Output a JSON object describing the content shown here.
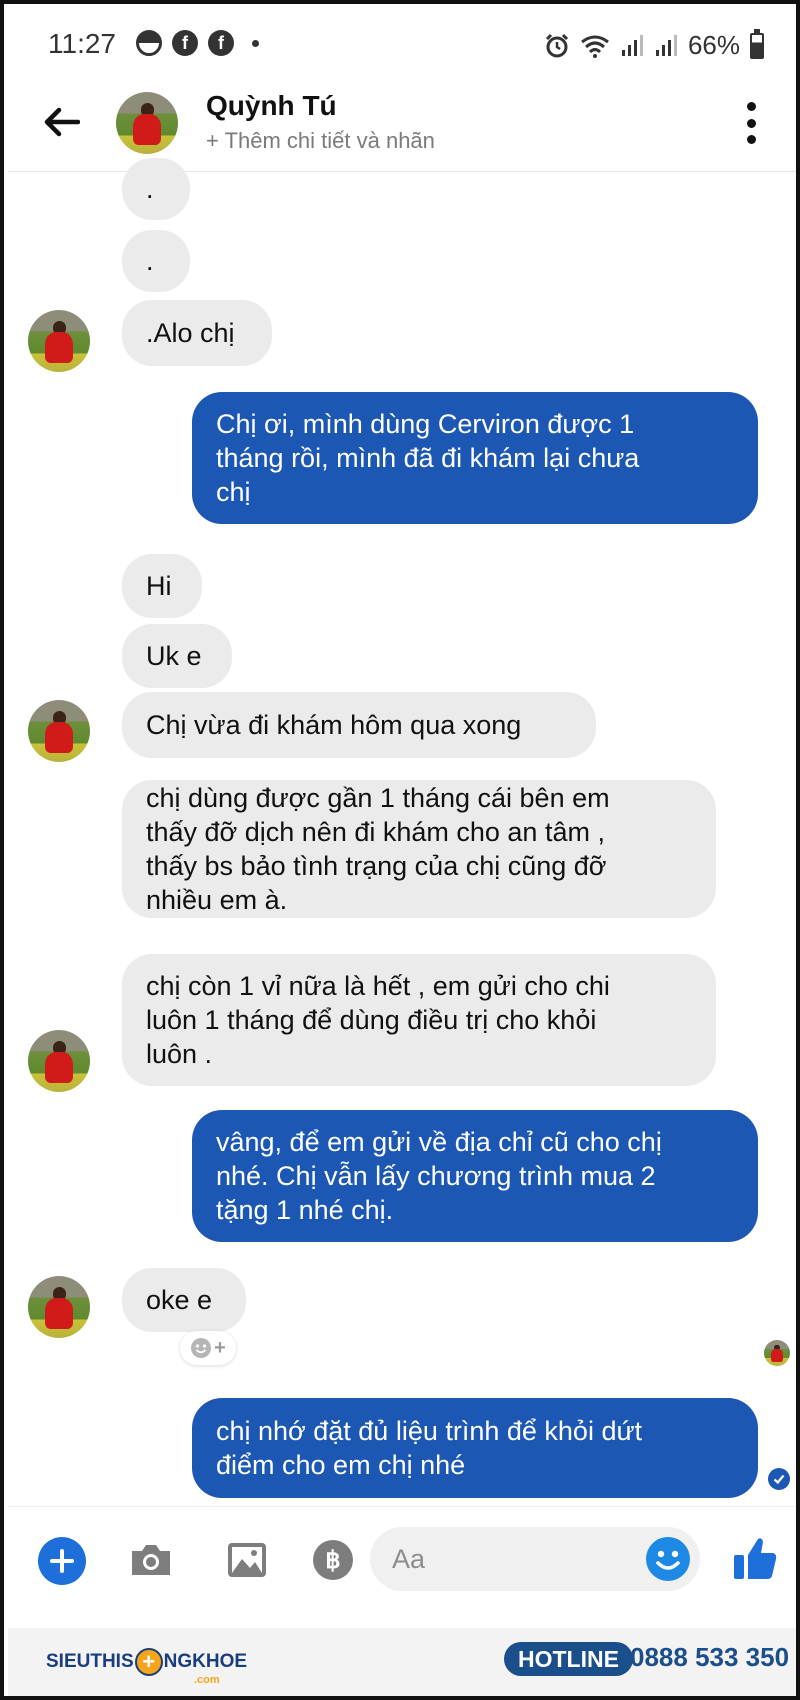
{
  "status_bar": {
    "time": "11:27",
    "battery": "66%"
  },
  "header": {
    "contact_name": "Quỳnh Tú",
    "subtitle": "+ Thêm chi tiết và nhãn"
  },
  "messages": [
    {
      "direction": "incoming",
      "text": "."
    },
    {
      "direction": "incoming",
      "text": "."
    },
    {
      "direction": "incoming",
      "text": ".Alo chị"
    },
    {
      "direction": "outgoing",
      "text": "Chị ơi, mình dùng Cerviron được 1\ntháng rồi, mình đã đi khám lại chưa\nchị"
    },
    {
      "direction": "incoming",
      "text": "Hi"
    },
    {
      "direction": "incoming",
      "text": "Uk e"
    },
    {
      "direction": "incoming",
      "text": "Chị vừa đi khám hôm qua xong"
    },
    {
      "direction": "incoming",
      "text": "chị dùng được gần 1 tháng cái bên em\nthấy đỡ dịch nên đi khám cho an tâm ,\nthấy bs bảo tình trạng của chị cũng đỡ\nnhiều em à."
    },
    {
      "direction": "incoming",
      "text": "chị còn 1 vỉ nữa là hết , em gửi cho chi\nluôn 1 tháng để dùng điều trị cho khỏi\nluôn ."
    },
    {
      "direction": "outgoing",
      "text": "vâng, để em gửi về địa chỉ cũ cho chị\nnhé. Chị vẫn lấy chương trình mua 2\ntặng 1 nhé chị."
    },
    {
      "direction": "incoming",
      "text": "oke e"
    },
    {
      "direction": "outgoing",
      "text": "chị nhớ đặt đủ liệu trình để khỏi dứt\nđiểm cho em chị nhé"
    }
  ],
  "reaction_add_label": "+",
  "composer": {
    "placeholder": "Aa"
  },
  "footer": {
    "brand_left": "SIEUTHIS",
    "brand_right": "NGKHOE",
    "brand_domain": ".com",
    "hotline_label": "HOTLINE",
    "hotline_number": "0888 533 350"
  },
  "colors": {
    "outgoing_bubble": "#1b57b3",
    "incoming_bubble": "#ebebeb",
    "accent": "#1e6fd9"
  }
}
